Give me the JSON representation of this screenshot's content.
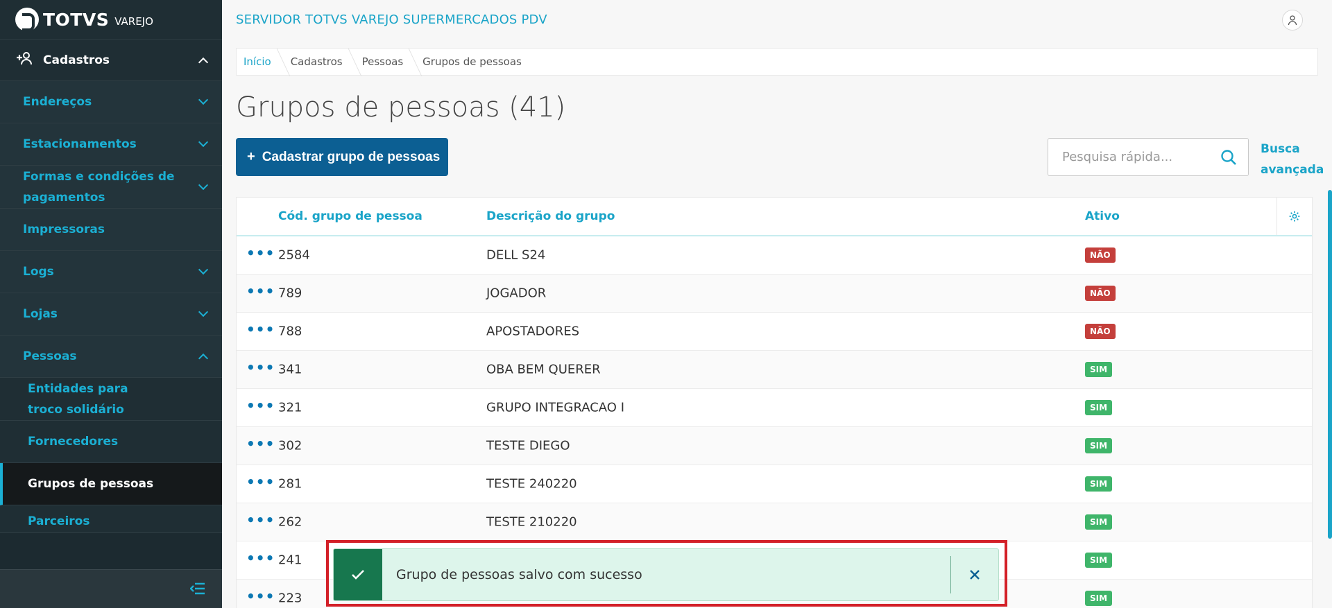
{
  "brand": {
    "name": "TOTVS",
    "sub": "VAREJO"
  },
  "header": {
    "title": "SERVIDOR TOTVS VAREJO SUPERMERCADOS PDV"
  },
  "sidebar": {
    "group": {
      "label": "Cadastros",
      "icon": "add-user-icon"
    },
    "items": [
      {
        "label": "Endereços"
      },
      {
        "label": "Estacionamentos"
      },
      {
        "label": "Formas e condições de pagamentos"
      },
      {
        "label": "Impressoras"
      },
      {
        "label": "Logs"
      },
      {
        "label": "Lojas"
      },
      {
        "label": "Pessoas"
      }
    ],
    "sub_items": [
      {
        "label": "Entidades para troco solidário"
      },
      {
        "label": "Fornecedores"
      },
      {
        "label": "Grupos de pessoas"
      },
      {
        "label": "Parceiros"
      }
    ]
  },
  "breadcrumb": [
    "Início",
    "Cadastros",
    "Pessoas",
    "Grupos de pessoas"
  ],
  "page": {
    "title": "Grupos de pessoas (41)",
    "add_button": "Cadastrar grupo de pessoas",
    "search_placeholder": "Pesquisa rápida...",
    "advanced_search": "Busca avançada"
  },
  "table": {
    "columns": [
      "Cód. grupo de pessoa",
      "Descrição do grupo",
      "Ativo"
    ],
    "rows": [
      {
        "code": "2584",
        "desc": "DELL S24",
        "active": "NÃO"
      },
      {
        "code": "789",
        "desc": "JOGADOR",
        "active": "NÃO"
      },
      {
        "code": "788",
        "desc": "APOSTADORES",
        "active": "NÃO"
      },
      {
        "code": "341",
        "desc": "OBA BEM QUERER",
        "active": "SIM"
      },
      {
        "code": "321",
        "desc": "GRUPO INTEGRACAO I",
        "active": "SIM"
      },
      {
        "code": "302",
        "desc": "TESTE DIEGO",
        "active": "SIM"
      },
      {
        "code": "281",
        "desc": "TESTE 240220",
        "active": "SIM"
      },
      {
        "code": "262",
        "desc": "TESTE 210220",
        "active": "SIM"
      },
      {
        "code": "241",
        "desc": "",
        "active": "SIM"
      },
      {
        "code": "223",
        "desc": "",
        "active": "SIM"
      }
    ]
  },
  "toast": {
    "message": "Grupo de pessoas salvo com sucesso"
  },
  "colors": {
    "accent": "#1aa4c8",
    "primary": "#0c5f93",
    "success": "#17774e",
    "danger": "#c43f3b",
    "sim": "#3fb56a",
    "sidebar_bg": "#1c2a30"
  }
}
